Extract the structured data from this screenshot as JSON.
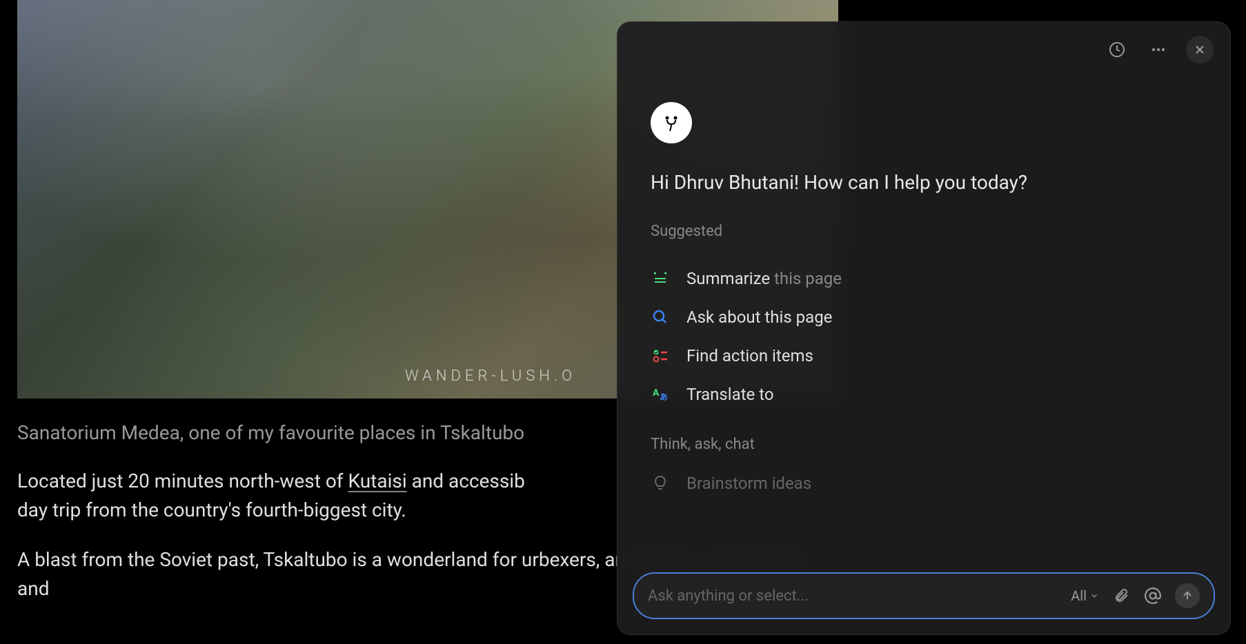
{
  "article": {
    "watermark": "WANDER-LUSH.O",
    "caption": "Sanatorium Medea, one of my favourite places in Tskaltubo",
    "paragraph1_part1": "Located just 20 minutes north-west of ",
    "paragraph1_link": "Kutaisi",
    "paragraph1_part2": " and accessib",
    "paragraph1_part3": "day trip from the country's fourth-biggest city.",
    "paragraph2": "A blast from the Soviet past, Tskaltubo is a wonderland for urbexers, architecture aficionados and"
  },
  "panel": {
    "avatar_glyph": "ᯓ",
    "greeting": "Hi Dhruv Bhutani! How can I help you today?",
    "suggested_label": "Suggested",
    "suggestions": [
      {
        "action": "Summarize",
        "suffix": "this page"
      },
      {
        "action": "Ask about this page",
        "suffix": ""
      },
      {
        "action": "Find action items",
        "suffix": ""
      },
      {
        "action": "Translate to",
        "suffix": ""
      }
    ],
    "think_label": "Think, ask, chat",
    "brainstorm": "Brainstorm ideas",
    "input_placeholder": "Ask anything or select...",
    "scope_label": "All"
  }
}
